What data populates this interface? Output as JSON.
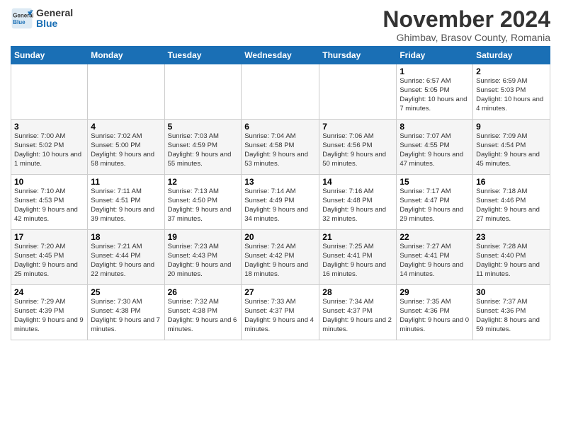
{
  "logo": {
    "general": "General",
    "blue": "Blue"
  },
  "title": "November 2024",
  "location": "Ghimbav, Brasov County, Romania",
  "weekdays": [
    "Sunday",
    "Monday",
    "Tuesday",
    "Wednesday",
    "Thursday",
    "Friday",
    "Saturday"
  ],
  "weeks": [
    [
      {
        "day": "",
        "info": ""
      },
      {
        "day": "",
        "info": ""
      },
      {
        "day": "",
        "info": ""
      },
      {
        "day": "",
        "info": ""
      },
      {
        "day": "",
        "info": ""
      },
      {
        "day": "1",
        "info": "Sunrise: 6:57 AM\nSunset: 5:05 PM\nDaylight: 10 hours and 7 minutes."
      },
      {
        "day": "2",
        "info": "Sunrise: 6:59 AM\nSunset: 5:03 PM\nDaylight: 10 hours and 4 minutes."
      }
    ],
    [
      {
        "day": "3",
        "info": "Sunrise: 7:00 AM\nSunset: 5:02 PM\nDaylight: 10 hours and 1 minute."
      },
      {
        "day": "4",
        "info": "Sunrise: 7:02 AM\nSunset: 5:00 PM\nDaylight: 9 hours and 58 minutes."
      },
      {
        "day": "5",
        "info": "Sunrise: 7:03 AM\nSunset: 4:59 PM\nDaylight: 9 hours and 55 minutes."
      },
      {
        "day": "6",
        "info": "Sunrise: 7:04 AM\nSunset: 4:58 PM\nDaylight: 9 hours and 53 minutes."
      },
      {
        "day": "7",
        "info": "Sunrise: 7:06 AM\nSunset: 4:56 PM\nDaylight: 9 hours and 50 minutes."
      },
      {
        "day": "8",
        "info": "Sunrise: 7:07 AM\nSunset: 4:55 PM\nDaylight: 9 hours and 47 minutes."
      },
      {
        "day": "9",
        "info": "Sunrise: 7:09 AM\nSunset: 4:54 PM\nDaylight: 9 hours and 45 minutes."
      }
    ],
    [
      {
        "day": "10",
        "info": "Sunrise: 7:10 AM\nSunset: 4:53 PM\nDaylight: 9 hours and 42 minutes."
      },
      {
        "day": "11",
        "info": "Sunrise: 7:11 AM\nSunset: 4:51 PM\nDaylight: 9 hours and 39 minutes."
      },
      {
        "day": "12",
        "info": "Sunrise: 7:13 AM\nSunset: 4:50 PM\nDaylight: 9 hours and 37 minutes."
      },
      {
        "day": "13",
        "info": "Sunrise: 7:14 AM\nSunset: 4:49 PM\nDaylight: 9 hours and 34 minutes."
      },
      {
        "day": "14",
        "info": "Sunrise: 7:16 AM\nSunset: 4:48 PM\nDaylight: 9 hours and 32 minutes."
      },
      {
        "day": "15",
        "info": "Sunrise: 7:17 AM\nSunset: 4:47 PM\nDaylight: 9 hours and 29 minutes."
      },
      {
        "day": "16",
        "info": "Sunrise: 7:18 AM\nSunset: 4:46 PM\nDaylight: 9 hours and 27 minutes."
      }
    ],
    [
      {
        "day": "17",
        "info": "Sunrise: 7:20 AM\nSunset: 4:45 PM\nDaylight: 9 hours and 25 minutes."
      },
      {
        "day": "18",
        "info": "Sunrise: 7:21 AM\nSunset: 4:44 PM\nDaylight: 9 hours and 22 minutes."
      },
      {
        "day": "19",
        "info": "Sunrise: 7:23 AM\nSunset: 4:43 PM\nDaylight: 9 hours and 20 minutes."
      },
      {
        "day": "20",
        "info": "Sunrise: 7:24 AM\nSunset: 4:42 PM\nDaylight: 9 hours and 18 minutes."
      },
      {
        "day": "21",
        "info": "Sunrise: 7:25 AM\nSunset: 4:41 PM\nDaylight: 9 hours and 16 minutes."
      },
      {
        "day": "22",
        "info": "Sunrise: 7:27 AM\nSunset: 4:41 PM\nDaylight: 9 hours and 14 minutes."
      },
      {
        "day": "23",
        "info": "Sunrise: 7:28 AM\nSunset: 4:40 PM\nDaylight: 9 hours and 11 minutes."
      }
    ],
    [
      {
        "day": "24",
        "info": "Sunrise: 7:29 AM\nSunset: 4:39 PM\nDaylight: 9 hours and 9 minutes."
      },
      {
        "day": "25",
        "info": "Sunrise: 7:30 AM\nSunset: 4:38 PM\nDaylight: 9 hours and 7 minutes."
      },
      {
        "day": "26",
        "info": "Sunrise: 7:32 AM\nSunset: 4:38 PM\nDaylight: 9 hours and 6 minutes."
      },
      {
        "day": "27",
        "info": "Sunrise: 7:33 AM\nSunset: 4:37 PM\nDaylight: 9 hours and 4 minutes."
      },
      {
        "day": "28",
        "info": "Sunrise: 7:34 AM\nSunset: 4:37 PM\nDaylight: 9 hours and 2 minutes."
      },
      {
        "day": "29",
        "info": "Sunrise: 7:35 AM\nSunset: 4:36 PM\nDaylight: 9 hours and 0 minutes."
      },
      {
        "day": "30",
        "info": "Sunrise: 7:37 AM\nSunset: 4:36 PM\nDaylight: 8 hours and 59 minutes."
      }
    ]
  ]
}
